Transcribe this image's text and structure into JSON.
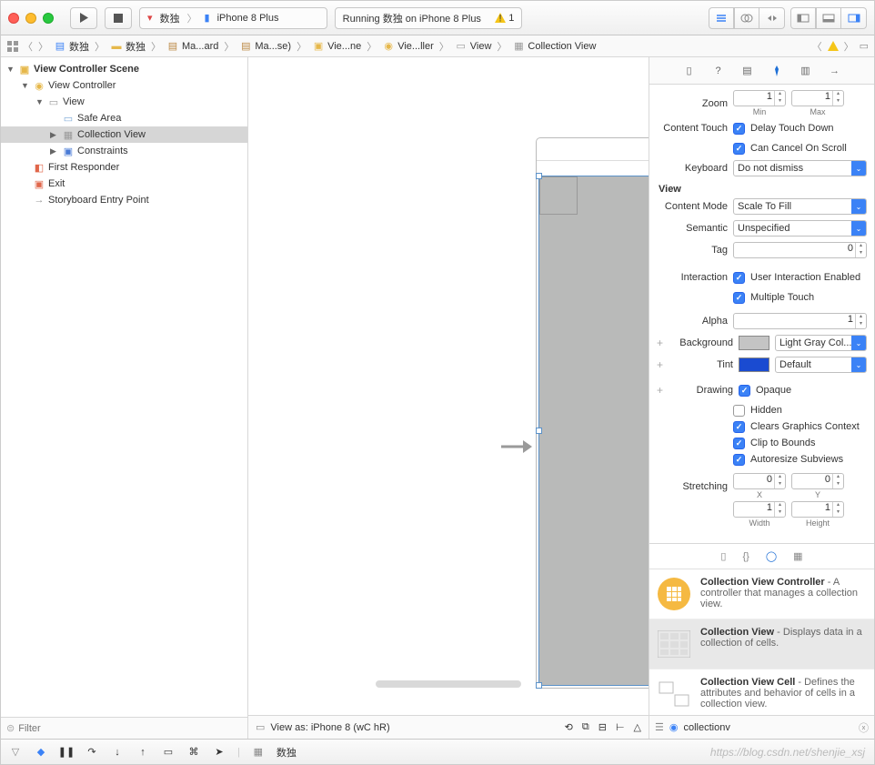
{
  "toolbar": {
    "scheme_app": "数独",
    "scheme_device": "iPhone 8 Plus",
    "status_text": "Running 数独 on iPhone 8 Plus",
    "warning_count": "1"
  },
  "pathbar": {
    "items": [
      "数独",
      "数独",
      "Ma...ard",
      "Ma...se)",
      "Vie...ne",
      "Vie...ller",
      "View",
      "Collection View"
    ]
  },
  "outline": {
    "title": "View Controller Scene",
    "rows": [
      {
        "label": "View Controller",
        "indent": 1,
        "disc": "▼",
        "icon": "vc"
      },
      {
        "label": "View",
        "indent": 2,
        "disc": "▼",
        "icon": "view"
      },
      {
        "label": "Safe Area",
        "indent": 3,
        "disc": "",
        "icon": "safe"
      },
      {
        "label": "Collection View",
        "indent": 3,
        "disc": "▶",
        "icon": "coll",
        "sel": true
      },
      {
        "label": "Constraints",
        "indent": 3,
        "disc": "▶",
        "icon": "const"
      },
      {
        "label": "First Responder",
        "indent": 1,
        "disc": "",
        "icon": "first"
      },
      {
        "label": "Exit",
        "indent": 1,
        "disc": "",
        "icon": "exit"
      },
      {
        "label": "Storyboard Entry Point",
        "indent": 1,
        "disc": "",
        "icon": "entry"
      }
    ],
    "filter_placeholder": "Filter"
  },
  "canvas": {
    "view_as": "View as: iPhone 8 (wC hR)"
  },
  "inspector": {
    "zoom_label": "Zoom",
    "zoom_min": "1",
    "zoom_max": "1",
    "zoom_min_l": "Min",
    "zoom_max_l": "Max",
    "content_touch_label": "Content Touch",
    "delay_touch": "Delay Touch Down",
    "cancel_scroll": "Can Cancel On Scroll",
    "keyboard_label": "Keyboard",
    "keyboard_value": "Do not dismiss",
    "section_view": "View",
    "content_mode_label": "Content Mode",
    "content_mode": "Scale To Fill",
    "semantic_label": "Semantic",
    "semantic": "Unspecified",
    "tag_label": "Tag",
    "tag": "0",
    "interaction_label": "Interaction",
    "uie": "User Interaction Enabled",
    "mt": "Multiple Touch",
    "alpha_label": "Alpha",
    "alpha": "1",
    "background_label": "Background",
    "background": "Light Gray Col...",
    "tint_label": "Tint",
    "tint": "Default",
    "drawing_label": "Drawing",
    "opaque": "Opaque",
    "hidden": "Hidden",
    "cgc": "Clears Graphics Context",
    "ctb": "Clip to Bounds",
    "asv": "Autoresize Subviews",
    "stretching_label": "Stretching",
    "sx": "0",
    "sy": "0",
    "sx_l": "X",
    "sy_l": "Y",
    "sw": "1",
    "sh": "1",
    "sw_l": "Width",
    "sh_l": "Height"
  },
  "library": {
    "items": [
      {
        "title": "Collection View Controller",
        "desc": " - A controller that manages a collection view.",
        "icon": "cvc"
      },
      {
        "title": "Collection View",
        "desc": " - Displays data in a collection of cells.",
        "icon": "cv",
        "sel": true
      },
      {
        "title": "Collection View Cell",
        "desc": " - Defines the attributes and behavior of cells in a collection view.",
        "icon": "cell"
      }
    ],
    "filter": "collectionv"
  },
  "debugbar": {
    "app": "数独"
  }
}
